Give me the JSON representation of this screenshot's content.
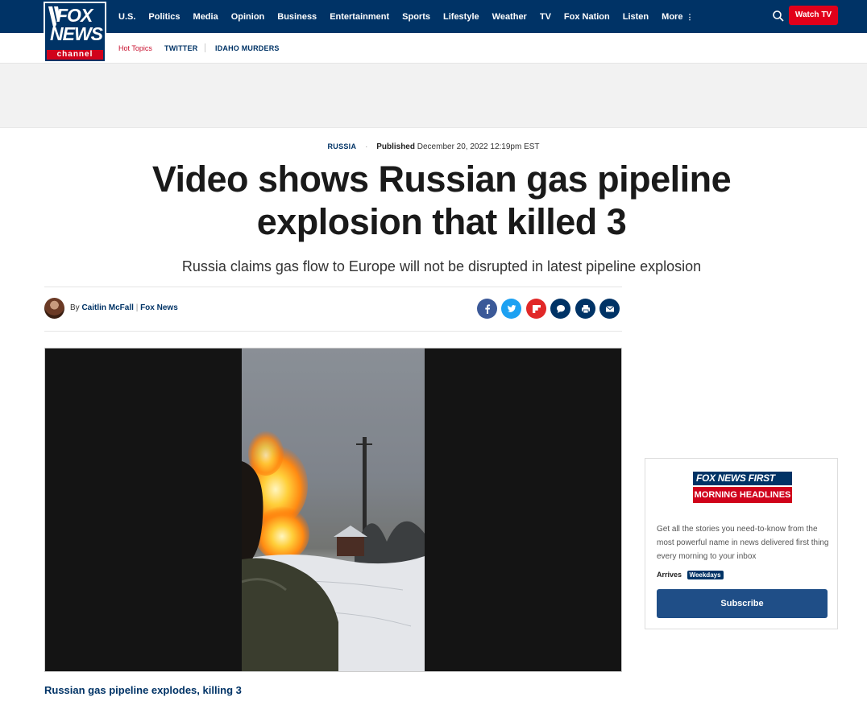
{
  "logo": {
    "line1": "FOX",
    "line2": "NEWS",
    "line3": "channel"
  },
  "nav": {
    "items": [
      "U.S.",
      "Politics",
      "Media",
      "Opinion",
      "Business",
      "Entertainment",
      "Sports",
      "Lifestyle",
      "Weather",
      "TV",
      "Fox Nation",
      "Listen",
      "More"
    ],
    "watch_tv": "Watch TV",
    "search_icon": "search-icon"
  },
  "hot_topics": {
    "label": "Hot Topics",
    "items": [
      "TWITTER",
      "IDAHO MURDERS"
    ]
  },
  "article": {
    "category": "RUSSIA",
    "published_label": "Published",
    "published_date": "December 20, 2022 12:19pm EST",
    "headline": "Video shows Russian gas pipeline explosion that killed 3",
    "subheadline": "Russia claims gas flow to Europe will not be disrupted in latest pipeline explosion",
    "byline_prefix": "By",
    "author": "Caitlin McFall",
    "org": "Fox News",
    "video_caption": "Russian gas pipeline explodes, killing 3"
  },
  "share_icons": [
    {
      "name": "facebook-icon",
      "glyph": "f",
      "color": "#3b5998"
    },
    {
      "name": "twitter-icon",
      "glyph": "t",
      "color": "#1da1f2"
    },
    {
      "name": "flipboard-icon",
      "glyph": "F",
      "color": "#e12828"
    },
    {
      "name": "comments-icon",
      "glyph": "c",
      "color": "#003366"
    },
    {
      "name": "print-icon",
      "glyph": "p",
      "color": "#003366"
    },
    {
      "name": "email-icon",
      "glyph": "e",
      "color": "#003366"
    }
  ],
  "newsletter": {
    "logo_top": "FOX NEWS FIRST",
    "logo_bottom": "MORNING HEADLINES",
    "description": "Get all the stories you need-to-know from the most powerful name in news delivered first thing every morning to your inbox",
    "arrives_label": "Arrives",
    "arrives_value": "Weekdays",
    "subscribe": "Subscribe"
  },
  "colors": {
    "navy": "#003366",
    "red": "#e2001a"
  }
}
